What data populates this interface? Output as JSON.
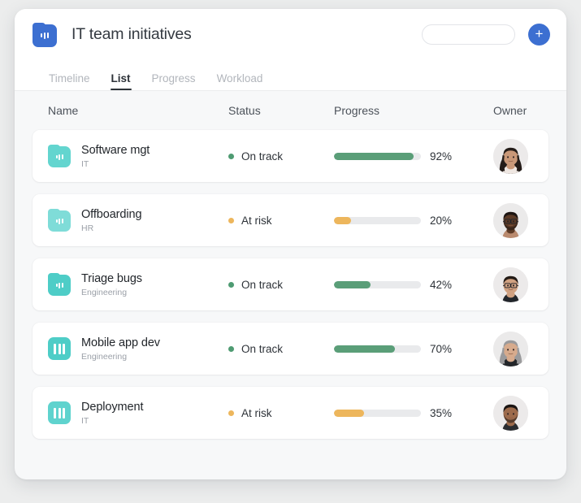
{
  "header": {
    "title": "IT team initiatives",
    "app_icon": "bar-chart-folder-icon",
    "icon_color": "#3c6fd1",
    "search": {
      "value": "",
      "placeholder": ""
    },
    "add_button_label": "+"
  },
  "tabs": [
    {
      "label": "Timeline",
      "active": false
    },
    {
      "label": "List",
      "active": true
    },
    {
      "label": "Progress",
      "active": false
    },
    {
      "label": "Workload",
      "active": false
    }
  ],
  "columns": {
    "name": "Name",
    "status": "Status",
    "progress": "Progress",
    "owner": "Owner"
  },
  "colors": {
    "accent_blue": "#3c6fd1",
    "teal_icon": "#5fd3ce",
    "teal_icon_alt": "#45c9c3",
    "status_on_track": "#4e9b72",
    "status_at_risk": "#e8b košt",
    "progress_green": "#5a9e78",
    "progress_amber": "#edb css",
    "track_gray": "#e9eaec"
  },
  "rows": [
    {
      "icon": "folder-chart-icon",
      "icon_color": "#63d5cf",
      "title": "Software mgt",
      "subtitle": "IT",
      "status": "On track",
      "status_color": "#4e9b72",
      "progress": 92,
      "progress_label": "92%",
      "progress_color": "#5a9e78",
      "owner_avatar": "woman-dark-hair-avatar"
    },
    {
      "icon": "folder-chart-icon",
      "icon_color": "#7fdcd8",
      "title": "Offboarding",
      "subtitle": "HR",
      "status": "At risk",
      "status_color": "#edb65c",
      "progress": 20,
      "progress_label": "20%",
      "progress_color": "#edb65c",
      "owner_avatar": "man-glasses-dark-skin-avatar"
    },
    {
      "icon": "folder-chart-icon",
      "icon_color": "#4ecdc7",
      "title": "Triage bugs",
      "subtitle": "Engineering",
      "status": "On track",
      "status_color": "#4e9b72",
      "progress": 42,
      "progress_label": "42%",
      "progress_color": "#5a9e78",
      "owner_avatar": "man-glasses-avatar"
    },
    {
      "icon": "board-columns-icon",
      "icon_color": "#4ecdc7",
      "title": "Mobile app dev",
      "subtitle": "Engineering",
      "status": "On track",
      "status_color": "#4e9b72",
      "progress": 70,
      "progress_label": "70%",
      "progress_color": "#5a9e78",
      "owner_avatar": "woman-gray-hair-avatar"
    },
    {
      "icon": "board-columns-icon",
      "icon_color": "#5fd3ce",
      "title": "Deployment",
      "subtitle": "IT",
      "status": "At risk",
      "status_color": "#edb65c",
      "progress": 35,
      "progress_label": "35%",
      "progress_color": "#edb65c",
      "owner_avatar": "man-short-hair-avatar"
    }
  ]
}
